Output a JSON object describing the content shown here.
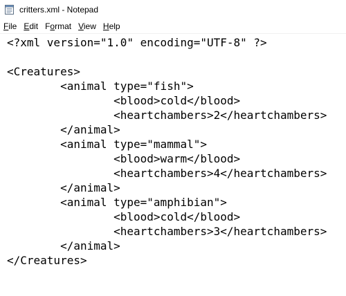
{
  "window": {
    "title": "critters.xml - Notepad"
  },
  "menu": [
    {
      "label_ul": "F",
      "label_rest": "ile"
    },
    {
      "label_ul": "E",
      "label_rest": "dit"
    },
    {
      "label_ul": "F",
      "label_rest": "ormat",
      "ul_first": false,
      "label_pre": "F",
      "label_ul2": "o"
    },
    {
      "label_ul": "V",
      "label_rest": "iew"
    },
    {
      "label_ul": "H",
      "label_rest": "elp"
    }
  ],
  "menu_items": [
    "File",
    "Edit",
    "Format",
    "View",
    "Help"
  ],
  "document": {
    "lines": [
      "<?xml version=\"1.0\" encoding=\"UTF-8\" ?>",
      "",
      "<Creatures>",
      "        <animal type=\"fish\">",
      "                <blood>cold</blood>",
      "                <heartchambers>2</heartchambers>",
      "        </animal>",
      "        <animal type=\"mammal\">",
      "                <blood>warm</blood>",
      "                <heartchambers>4</heartchambers>",
      "        </animal>",
      "        <animal type=\"amphibian\">",
      "                <blood>cold</blood>",
      "                <heartchambers>3</heartchambers>",
      "        </animal>",
      "</Creatures>"
    ]
  },
  "icons": {
    "app": "notepad-icon"
  }
}
